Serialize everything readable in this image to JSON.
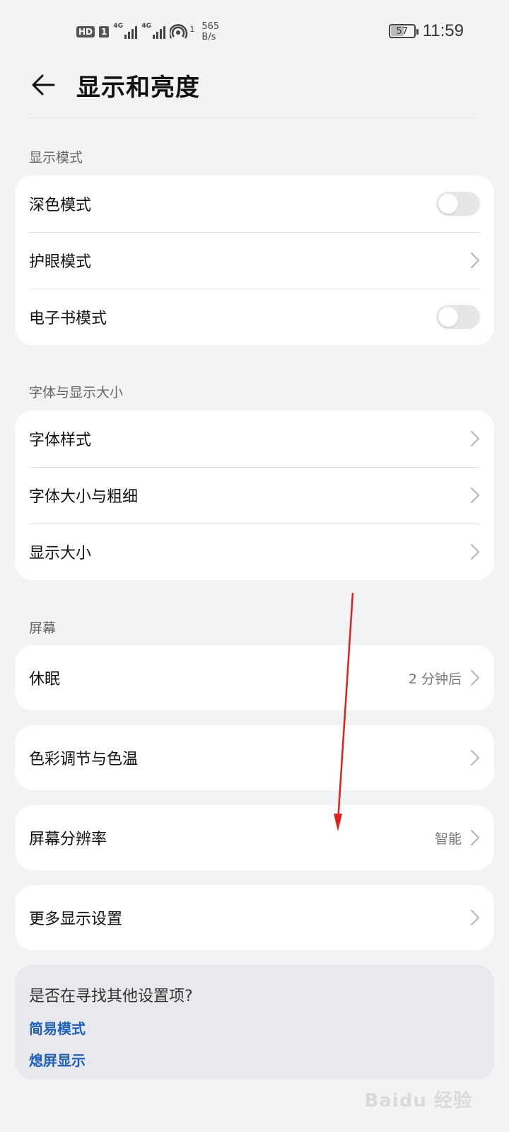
{
  "status_bar": {
    "hd": "HD",
    "sim1": "1",
    "net_type_1": "4G",
    "net_type_2": "4G",
    "hotspot_sub": "1",
    "speed_value": "565",
    "speed_unit": "B/s",
    "battery": "57",
    "battery_level": 0.57,
    "time": "11:59"
  },
  "header": {
    "title": "显示和亮度"
  },
  "sections": {
    "display_mode": {
      "label": "显示模式",
      "items": [
        {
          "label": "深色模式",
          "control": "toggle",
          "state": "off"
        },
        {
          "label": "护眼模式",
          "control": "chevron"
        },
        {
          "label": "电子书模式",
          "control": "toggle",
          "state": "off"
        }
      ]
    },
    "font_size": {
      "label": "字体与显示大小",
      "items": [
        {
          "label": "字体样式"
        },
        {
          "label": "字体大小与粗细"
        },
        {
          "label": "显示大小"
        }
      ]
    },
    "screen": {
      "label": "屏幕",
      "sleep": {
        "label": "休眠",
        "value": "2 分钟后"
      },
      "color": {
        "label": "色彩调节与色温"
      },
      "resolution": {
        "label": "屏幕分辨率",
        "value": "智能"
      },
      "more": {
        "label": "更多显示设置"
      }
    }
  },
  "suggestions": {
    "question": "是否在寻找其他设置项?",
    "links": [
      "简易模式",
      "熄屏显示"
    ]
  },
  "watermark": "Baidu 经验",
  "colors": {
    "background": "#f1f3f5",
    "card": "#ffffff",
    "link": "#1f5fbf",
    "annotation_arrow": "#e0201c"
  }
}
